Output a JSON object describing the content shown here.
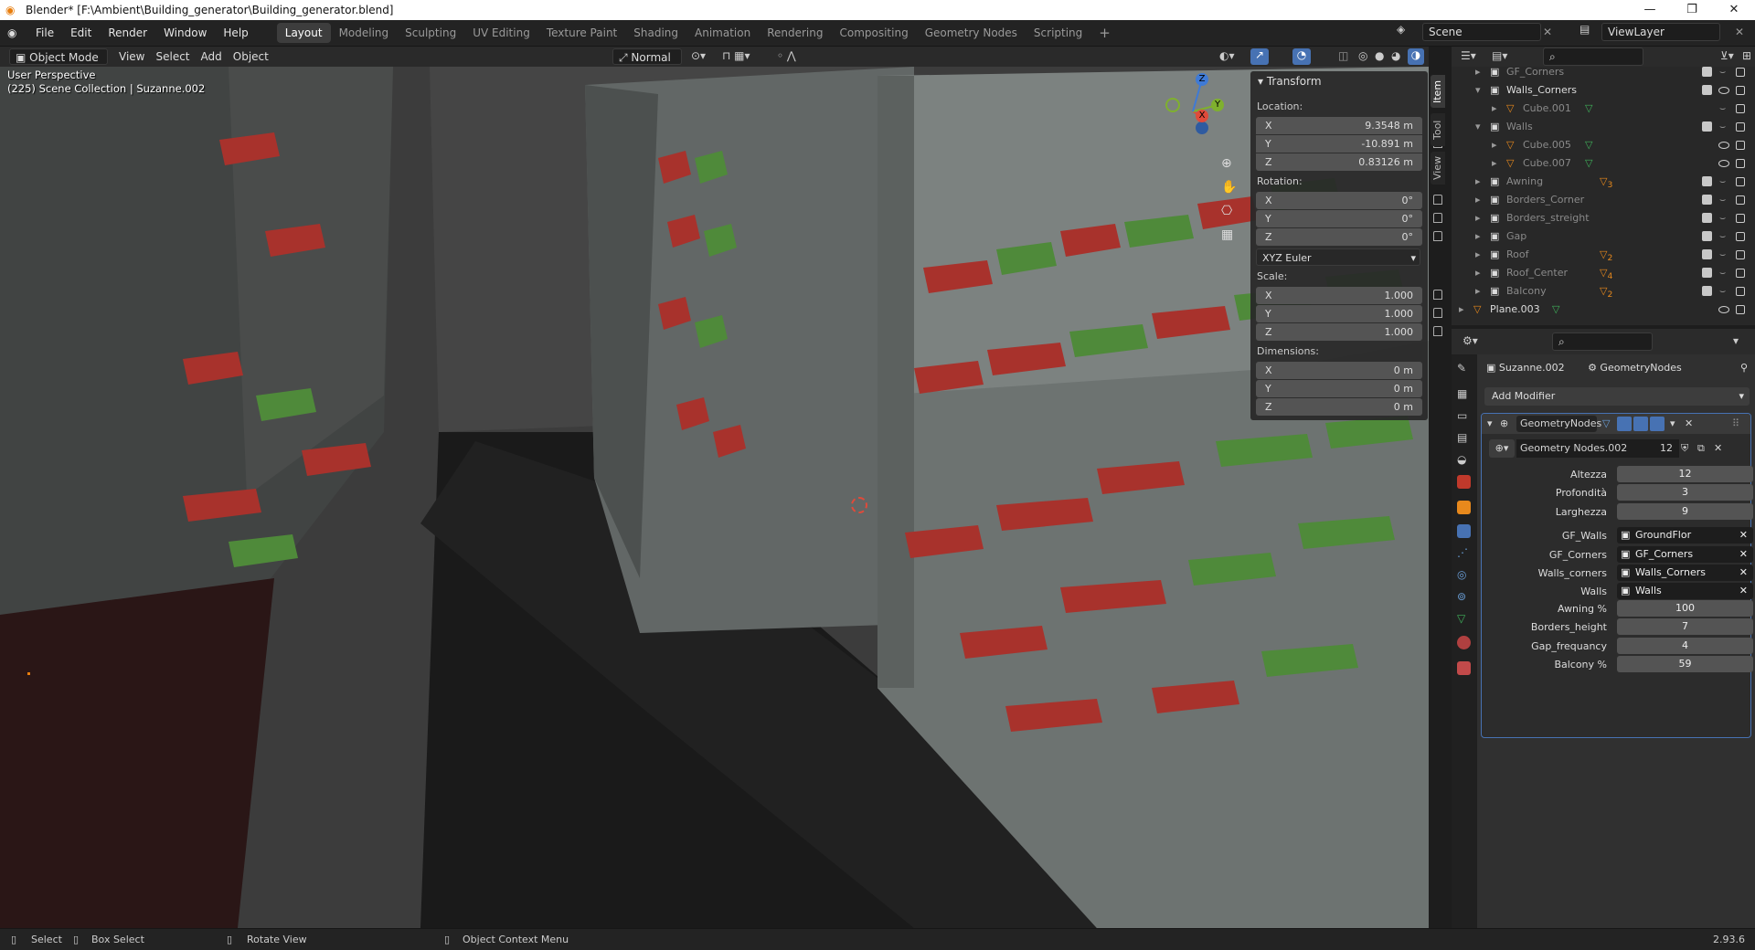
{
  "window": {
    "title": "Blender* [F:\\Ambient\\Building_generator\\Building_generator.blend]",
    "controls": [
      "—",
      "❐",
      "✕"
    ]
  },
  "menus": [
    "File",
    "Edit",
    "Render",
    "Window",
    "Help"
  ],
  "workspaces": [
    "Layout",
    "Modeling",
    "Sculpting",
    "UV Editing",
    "Texture Paint",
    "Shading",
    "Animation",
    "Rendering",
    "Compositing",
    "Geometry Nodes",
    "Scripting"
  ],
  "active_workspace": "Layout",
  "add_workspace": "+",
  "scene": "Scene",
  "view_layer": "ViewLayer",
  "viewport_header": {
    "mode": "Object Mode",
    "menus": [
      "View",
      "Select",
      "Add",
      "Object"
    ],
    "orientation": "Normal"
  },
  "viewport": {
    "perspective": "User Perspective",
    "collection": "(225) Scene Collection | Suzanne.002",
    "gizmo": {
      "x": "X",
      "y": "Y",
      "z": "Z"
    }
  },
  "transform": {
    "title": "Transform",
    "location_label": "Location:",
    "location": [
      {
        "axis": "X",
        "value": "9.3548 m"
      },
      {
        "axis": "Y",
        "value": "-10.891 m"
      },
      {
        "axis": "Z",
        "value": "0.83126 m"
      }
    ],
    "rotation_label": "Rotation:",
    "rotation": [
      {
        "axis": "X",
        "value": "0°"
      },
      {
        "axis": "Y",
        "value": "0°"
      },
      {
        "axis": "Z",
        "value": "0°"
      }
    ],
    "rotation_mode": "XYZ Euler",
    "scale_label": "Scale:",
    "scale": [
      {
        "axis": "X",
        "value": "1.000"
      },
      {
        "axis": "Y",
        "value": "1.000"
      },
      {
        "axis": "Z",
        "value": "1.000"
      }
    ],
    "dimensions_label": "Dimensions:",
    "dimensions": [
      {
        "axis": "X",
        "value": "0 m"
      },
      {
        "axis": "Y",
        "value": "0 m"
      },
      {
        "axis": "Z",
        "value": "0 m"
      }
    ]
  },
  "sidebar_tabs": [
    "Item",
    "Tool",
    "View"
  ],
  "outliner": {
    "items": [
      {
        "name": "GF_Corners",
        "badge": ""
      },
      {
        "name": "Walls_Corners",
        "badge": ""
      },
      {
        "name": "Cube.001",
        "badge": ""
      },
      {
        "name": "Walls",
        "badge": ""
      },
      {
        "name": "Cube.005",
        "badge": ""
      },
      {
        "name": "Cube.007",
        "badge": ""
      },
      {
        "name": "Awning",
        "badge": "3"
      },
      {
        "name": "Borders_Corner",
        "badge": ""
      },
      {
        "name": "Borders_streight",
        "badge": ""
      },
      {
        "name": "Gap",
        "badge": ""
      },
      {
        "name": "Roof",
        "badge": "2"
      },
      {
        "name": "Roof_Center",
        "badge": "4"
      },
      {
        "name": "Balcony",
        "badge": "2"
      },
      {
        "name": "Plane.003",
        "badge": ""
      }
    ]
  },
  "properties": {
    "object_name": "Suzanne.002",
    "modifier_crumb": "GeometryNodes",
    "add_modifier": "Add Modifier",
    "modifier_name": "GeometryNodes",
    "node_group": "Geometry Nodes.002",
    "node_group_users": "12",
    "inputs": [
      {
        "label": "Altezza",
        "value": "12",
        "kind": "num"
      },
      {
        "label": "Profondità",
        "value": "3",
        "kind": "num"
      },
      {
        "label": "Larghezza",
        "value": "9",
        "kind": "num"
      },
      {
        "label": "GF_Walls",
        "value": "GroundFlor",
        "kind": "obj"
      },
      {
        "label": "GF_Corners",
        "value": "GF_Corners",
        "kind": "obj"
      },
      {
        "label": "Walls_corners",
        "value": "Walls_Corners",
        "kind": "obj"
      },
      {
        "label": "Walls",
        "value": "Walls",
        "kind": "obj"
      },
      {
        "label": "Awning %",
        "value": "100",
        "kind": "num"
      },
      {
        "label": "Borders_height",
        "value": "7",
        "kind": "num"
      },
      {
        "label": "Gap_frequancy",
        "value": "4",
        "kind": "num"
      },
      {
        "label": "Balcony %",
        "value": "59",
        "kind": "num"
      }
    ]
  },
  "statusbar": {
    "select": "Select",
    "box_select": "Box Select",
    "rotate_view": "Rotate View",
    "context_menu": "Object Context Menu",
    "version": "2.93.6"
  },
  "colors": {
    "accent": "#4772b3",
    "awning_red": "#a8322c",
    "awning_green": "#4f8a3a",
    "building_light": "#8c9290",
    "building_dark": "#3b3d3c",
    "street": "#1b1b1b"
  }
}
